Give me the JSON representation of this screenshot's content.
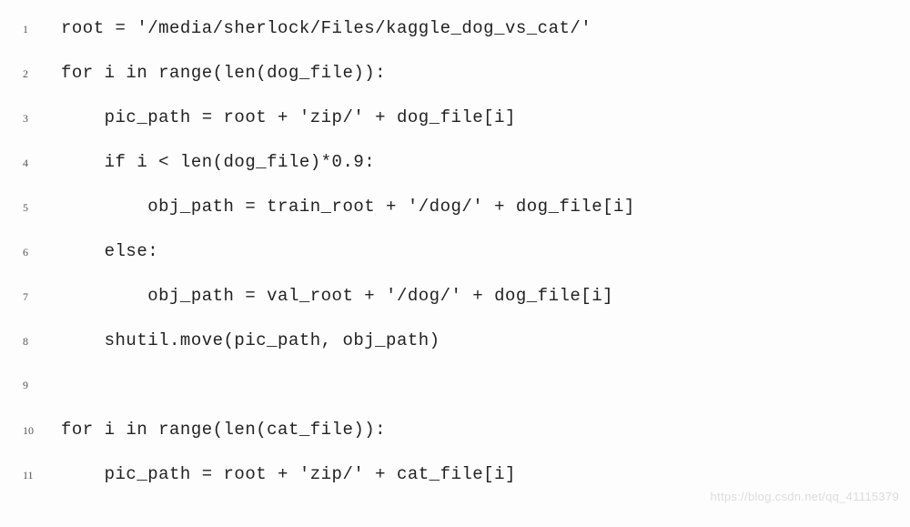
{
  "code": {
    "lines": [
      {
        "num": "1",
        "text": "root = '/media/sherlock/Files/kaggle_dog_vs_cat/'"
      },
      {
        "num": "2",
        "text": "for i in range(len(dog_file)):"
      },
      {
        "num": "3",
        "text": "    pic_path = root + 'zip/' + dog_file[i]"
      },
      {
        "num": "4",
        "text": "    if i < len(dog_file)*0.9:"
      },
      {
        "num": "5",
        "text": "        obj_path = train_root + '/dog/' + dog_file[i]"
      },
      {
        "num": "6",
        "text": "    else:"
      },
      {
        "num": "7",
        "text": "        obj_path = val_root + '/dog/' + dog_file[i]"
      },
      {
        "num": "8",
        "text": "    shutil.move(pic_path, obj_path)"
      },
      {
        "num": "9",
        "text": ""
      },
      {
        "num": "10",
        "text": "for i in range(len(cat_file)):"
      },
      {
        "num": "11",
        "text": "    pic_path = root + 'zip/' + cat_file[i]"
      }
    ]
  },
  "watermark": "https://blog.csdn.net/qq_41115379"
}
